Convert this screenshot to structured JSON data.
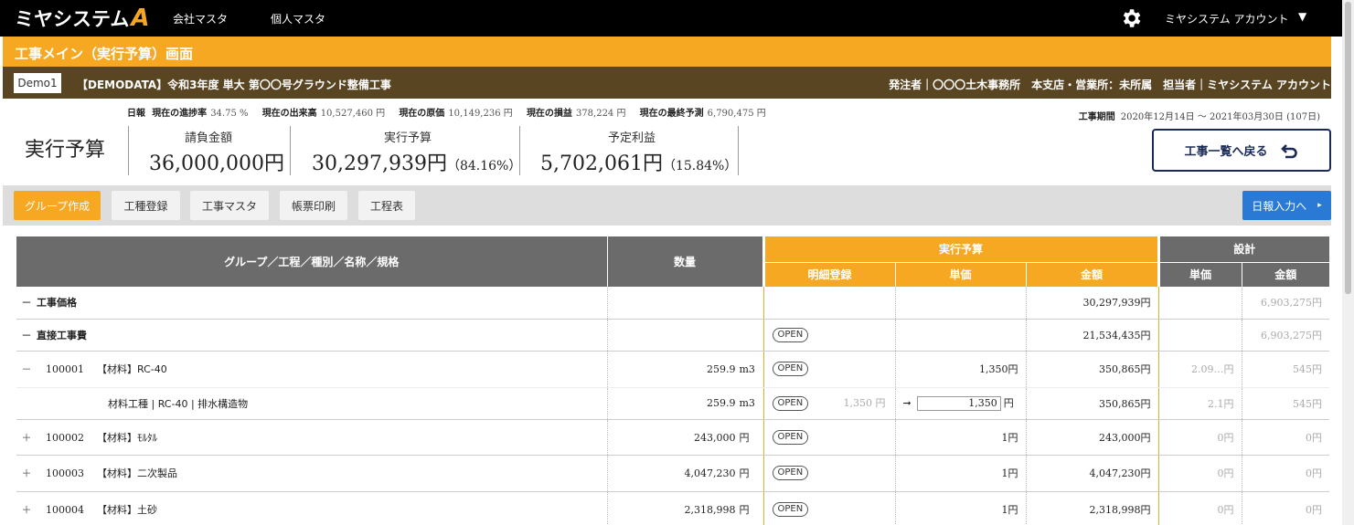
{
  "app": {
    "logo_text": "ミヤシステム",
    "logo_accent": "A",
    "nav": [
      "会社マスタ",
      "個人マスタ"
    ],
    "account": "ミヤシステム アカウント",
    "caret": "▼"
  },
  "title": "工事メイン（実行予算）画面",
  "info": {
    "demo": "Demo1",
    "project": "【DEMODATA】令和3年度 単大 第〇〇号グラウンド整備工事",
    "client": "発注者｜〇〇〇土木事務所　本支店・営業所：未所属　担当者｜ミヤシステム アカウント"
  },
  "summary": {
    "stats": [
      {
        "label": "日報",
        "value": ""
      },
      {
        "label": "現在の進捗率",
        "value": "34.75 %"
      },
      {
        "label": "現在の出来高",
        "value": "10,527,460 円"
      },
      {
        "label": "現在の原価",
        "value": "10,149,236 円"
      },
      {
        "label": "現在の損益",
        "value": "378,224 円"
      },
      {
        "label": "現在の最終予測",
        "value": "6,790,475 円"
      }
    ],
    "period_label": "工事期間",
    "period_value": "2020年12月14日 〜 2021年03月30日 (107日)",
    "page_title": "実行予算",
    "metrics": [
      {
        "label": "請負金額",
        "value": "36,000,000円",
        "sub": ""
      },
      {
        "label": "実行予算",
        "value": "30,297,939円",
        "sub": "（84.16%）"
      },
      {
        "label": "予定利益",
        "value": "5,702,061円",
        "sub": "（15.84%）"
      }
    ],
    "back_button": "工事一覧へ戻る"
  },
  "toolbar": {
    "buttons": [
      "グループ作成",
      "工種登録",
      "工事マスタ",
      "帳票印刷",
      "工程表"
    ],
    "report_button": "日報入力へ",
    "report_arrow": "▸"
  },
  "table": {
    "headers": {
      "name": "グループ／工程／種別／名称／規格",
      "qty": "数量",
      "budget": "実行予算",
      "detail": "明細登録",
      "unit_price": "単価",
      "amount": "金額",
      "design": "設計",
      "d_unit_price": "単価",
      "d_amount": "金額"
    },
    "open_label": "OPEN",
    "arrow": "➞",
    "rows": [
      {
        "toggle": "－",
        "code": "",
        "name": "工事価格",
        "qty": "",
        "unit": "",
        "open": false,
        "detail_price": "",
        "unit_price": "",
        "amount": "30,297,939円",
        "d_unit": "",
        "d_amount": "6,903,275円"
      },
      {
        "toggle": "－",
        "code": "",
        "name": "直接工事費",
        "qty": "",
        "unit": "",
        "open": true,
        "detail_price": "",
        "unit_price": "",
        "amount": "21,534,435円",
        "d_unit": "",
        "d_amount": "6,903,275円"
      },
      {
        "toggle": "－",
        "code": "100001",
        "name": "【材料】RC-40",
        "qty": "259.9",
        "unit": "m3",
        "open": true,
        "detail_price": "",
        "unit_price": "1,350円",
        "amount": "350,865円",
        "d_unit": "2.09…円",
        "d_amount": "545円"
      },
      {
        "toggle": "",
        "code": "",
        "name": "材料工種 | RC-40 | 排水構造物",
        "qty": "259.9",
        "unit": "m3",
        "open": true,
        "detail_price": "1,350 円",
        "unit_price_input": "1,350",
        "unit_price": "円",
        "amount": "350,865円",
        "d_unit": "2.1円",
        "d_amount": "545円"
      },
      {
        "toggle": "＋",
        "code": "100002",
        "name": "【材料】ﾓﾙﾀﾙ",
        "qty": "243,000",
        "unit": "円",
        "open": true,
        "detail_price": "",
        "unit_price": "1円",
        "amount": "243,000円",
        "d_unit": "0円",
        "d_amount": "0円"
      },
      {
        "toggle": "＋",
        "code": "100003",
        "name": "【材料】二次製品",
        "qty": "4,047,230",
        "unit": "円",
        "open": true,
        "detail_price": "",
        "unit_price": "1円",
        "amount": "4,047,230円",
        "d_unit": "0円",
        "d_amount": "0円"
      },
      {
        "toggle": "＋",
        "code": "100004",
        "name": "【材料】土砂",
        "qty": "2,318,998",
        "unit": "円",
        "open": true,
        "detail_price": "",
        "unit_price": "1円",
        "amount": "2,318,998円",
        "d_unit": "0円",
        "d_amount": "0円"
      }
    ]
  },
  "colors": {
    "accent": "#f7a823",
    "brown": "#5a4522",
    "navy": "#1a2a55",
    "blue": "#2a7ad5"
  }
}
